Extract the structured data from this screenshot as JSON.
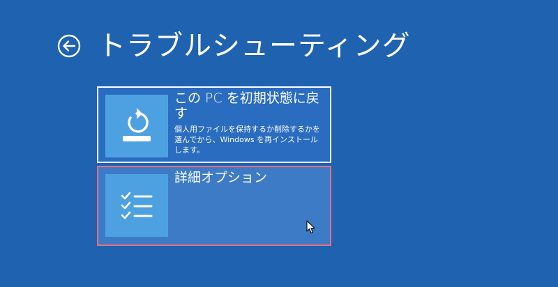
{
  "header": {
    "title": "トラブルシューティング",
    "back_icon": "back-arrow-circle-icon"
  },
  "options": [
    {
      "title": "この PC を初期状態に戻す",
      "description": "個人用ファイルを保持するか削除するかを選んでから、Windows を再インストールします。",
      "icon": "reset-pc-icon"
    },
    {
      "title": "詳細オプション",
      "description": "",
      "icon": "checklist-icon"
    }
  ],
  "colors": {
    "background": "#1f62b0",
    "tile": "#2a6cc0",
    "tile_hover": "#3d7bc6",
    "icon_box": "#4ea1e0",
    "highlight_border": "#e8707f",
    "text": "#ffffff"
  }
}
